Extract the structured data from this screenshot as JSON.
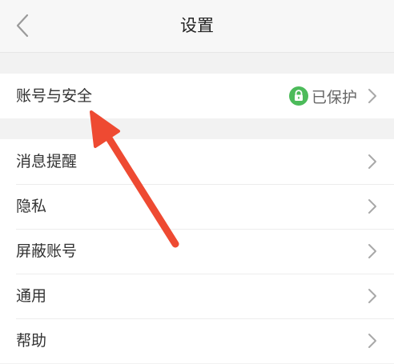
{
  "header": {
    "title": "设置"
  },
  "account": {
    "label": "账号与安全",
    "status": "已保护"
  },
  "menu": {
    "items": [
      {
        "label": "消息提醒"
      },
      {
        "label": "隐私"
      },
      {
        "label": "屏蔽账号"
      },
      {
        "label": "通用"
      },
      {
        "label": "帮助"
      }
    ]
  },
  "colors": {
    "accent_green": "#4cbb5a",
    "annotation_arrow": "#ee4a32"
  },
  "icons": {
    "back": "chevron-left-icon",
    "row_arrow": "chevron-right-icon",
    "lock": "lock-icon"
  }
}
